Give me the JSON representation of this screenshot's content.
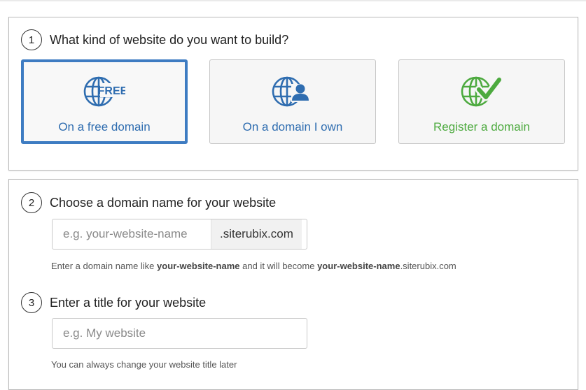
{
  "step1": {
    "number": "1",
    "title": "What kind of website do you want to build?",
    "options": [
      {
        "label": "On a free domain",
        "icon": "globe-free-icon",
        "icon_text": "FREE",
        "color": "#2f6db0",
        "selected": true
      },
      {
        "label": "On a domain I own",
        "icon": "globe-user-icon",
        "color": "#2f6db0",
        "selected": false
      },
      {
        "label": "Register a domain",
        "icon": "globe-check-icon",
        "color": "#4daa3f",
        "selected": false
      }
    ]
  },
  "step2": {
    "number": "2",
    "title": "Choose a domain name for your website",
    "placeholder": "e.g. your-website-name",
    "suffix": ".siterubix.com",
    "hint_prefix": "Enter a domain name like ",
    "hint_bold_1": "your-website-name",
    "hint_middle": " and it will become ",
    "hint_bold_2": "your-website-name",
    "hint_suffix": ".siterubix.com"
  },
  "step3": {
    "number": "3",
    "title": "Enter a title for your website",
    "placeholder": "e.g. My website",
    "hint": "You can always change your website title later"
  },
  "colors": {
    "accent_blue": "#3e7cc2",
    "text_blue": "#2f6db0",
    "green": "#4daa3f"
  }
}
